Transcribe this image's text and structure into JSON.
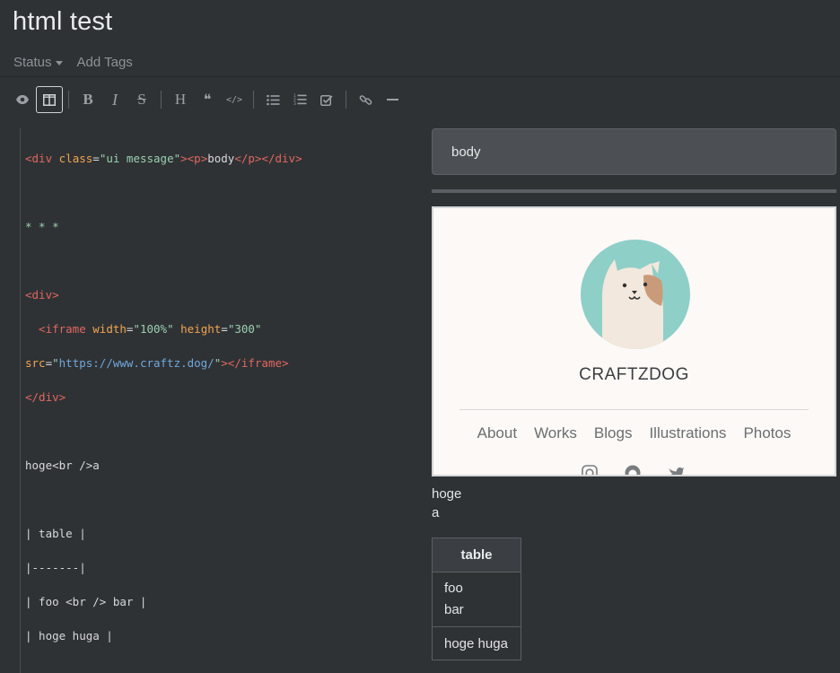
{
  "note": {
    "title": "html test",
    "status_label": "Status",
    "add_tags_label": "Add Tags"
  },
  "toolbar": {
    "items": [
      "preview",
      "side-by-side",
      "bold",
      "italic",
      "strikethrough",
      "heading",
      "quote",
      "code",
      "unordered-list",
      "ordered-list",
      "task-list",
      "link",
      "horizontal-rule"
    ],
    "active": "side-by-side",
    "bold_glyph": "B",
    "italic_glyph": "I",
    "strike_glyph": "S",
    "heading_glyph": "H",
    "quote_glyph": "❝",
    "code_glyph": "</>"
  },
  "editor": {
    "line1": [
      "<div ",
      "class",
      "=",
      "\"ui message\"",
      "><p>",
      "body",
      "</p></div>"
    ],
    "line2": "* * *",
    "line3": "<div>",
    "line4": [
      "  <iframe ",
      "width",
      "=",
      "\"100%\"",
      " ",
      "height",
      "=",
      "\"300\""
    ],
    "line5": [
      "src",
      "=",
      "\"",
      "https://www.craftz.dog/",
      "\"",
      "></iframe>"
    ],
    "line6": "</div>",
    "line7": "hoge<br />a",
    "line8": "| table |",
    "line9": "|-------|",
    "line10": "| foo <br /> bar |",
    "line11": "| hoge huga |"
  },
  "preview": {
    "message_text": "body",
    "embed": {
      "site_name": "CRAFTZDOG",
      "nav": [
        "About",
        "Works",
        "Blogs",
        "Illustrations",
        "Photos"
      ],
      "social_icons": [
        "instagram-icon",
        "github-icon",
        "twitter-icon"
      ]
    },
    "text_line1": "hoge",
    "text_line2": "a",
    "table": {
      "header": "table",
      "row1_line1": "foo",
      "row1_line2": "bar",
      "row2": "hoge huga"
    }
  },
  "colors": {
    "background": "#2f3235",
    "message_bg": "#4c5055",
    "avatar_teal": "#8ecfc8",
    "code_tag": "#e0675f",
    "code_attr": "#f1a550",
    "code_string": "#9bd0b0",
    "code_url": "#6fa8dc"
  }
}
